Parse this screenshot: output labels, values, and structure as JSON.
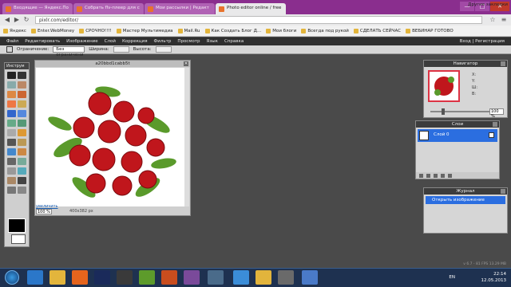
{
  "browser": {
    "tabs": [
      {
        "label": "Входящие — Яндекс.По",
        "active": false
      },
      {
        "label": "Собрать flv-плеер для с",
        "active": false
      },
      {
        "label": "Мои рассылки | Редакт",
        "active": false
      },
      {
        "label": "Photo editor online / free",
        "active": true
      }
    ],
    "window_controls": [
      "—",
      "□",
      "✕"
    ],
    "url": "pixlr.com/editor/",
    "bookmarks": [
      "Яндекс",
      "Enter.WebMoney",
      "СРОЧНО!!!!",
      "Мастер Мультимедиа",
      "Mail.Ru",
      "Как Создать Блог Д...",
      "Мои блоги",
      "Всегда под рукой",
      "СДЕЛАТЬ СЕЙЧАС",
      "ВЕБИНАР ГОТОВО"
    ],
    "bookmarks_other": "Другие закладки"
  },
  "menu": {
    "items": [
      "Файл",
      "Редактировать",
      "Изображение",
      "Слой",
      "Коррекция",
      "Фильтр",
      "Просмотр",
      "Язык",
      "Справка"
    ],
    "right": "Вход | Регистрация"
  },
  "options": {
    "constraint_label": "Ограничение:",
    "constraint_value": "Без ограничени",
    "width_label": "Ширина:",
    "height_label": "Высота:"
  },
  "tools_panel": {
    "title": "Инструм"
  },
  "image_window": {
    "title": "a20bbd1cabb5t",
    "enlarge_link": "увеличить",
    "zoom": "100",
    "zoom_unit": "%",
    "dimensions": "400x382 px"
  },
  "navigator": {
    "title": "Навигатор",
    "x_label": "X:",
    "y_label": "Y:",
    "w_label": "Ш:",
    "h_label": "В:",
    "zoom": "100",
    "zoom_unit": "%"
  },
  "layers": {
    "title": "Слои",
    "items": [
      {
        "name": "Слой 0"
      }
    ]
  },
  "journal": {
    "title": "Журнал",
    "entries": [
      "Открыть изображение"
    ]
  },
  "status": {
    "version": "v 6.7 - 81 FPS 13.29 MB"
  },
  "taskbar": {
    "lang": "EN",
    "time": "22:14",
    "date": "12.05.2013"
  }
}
